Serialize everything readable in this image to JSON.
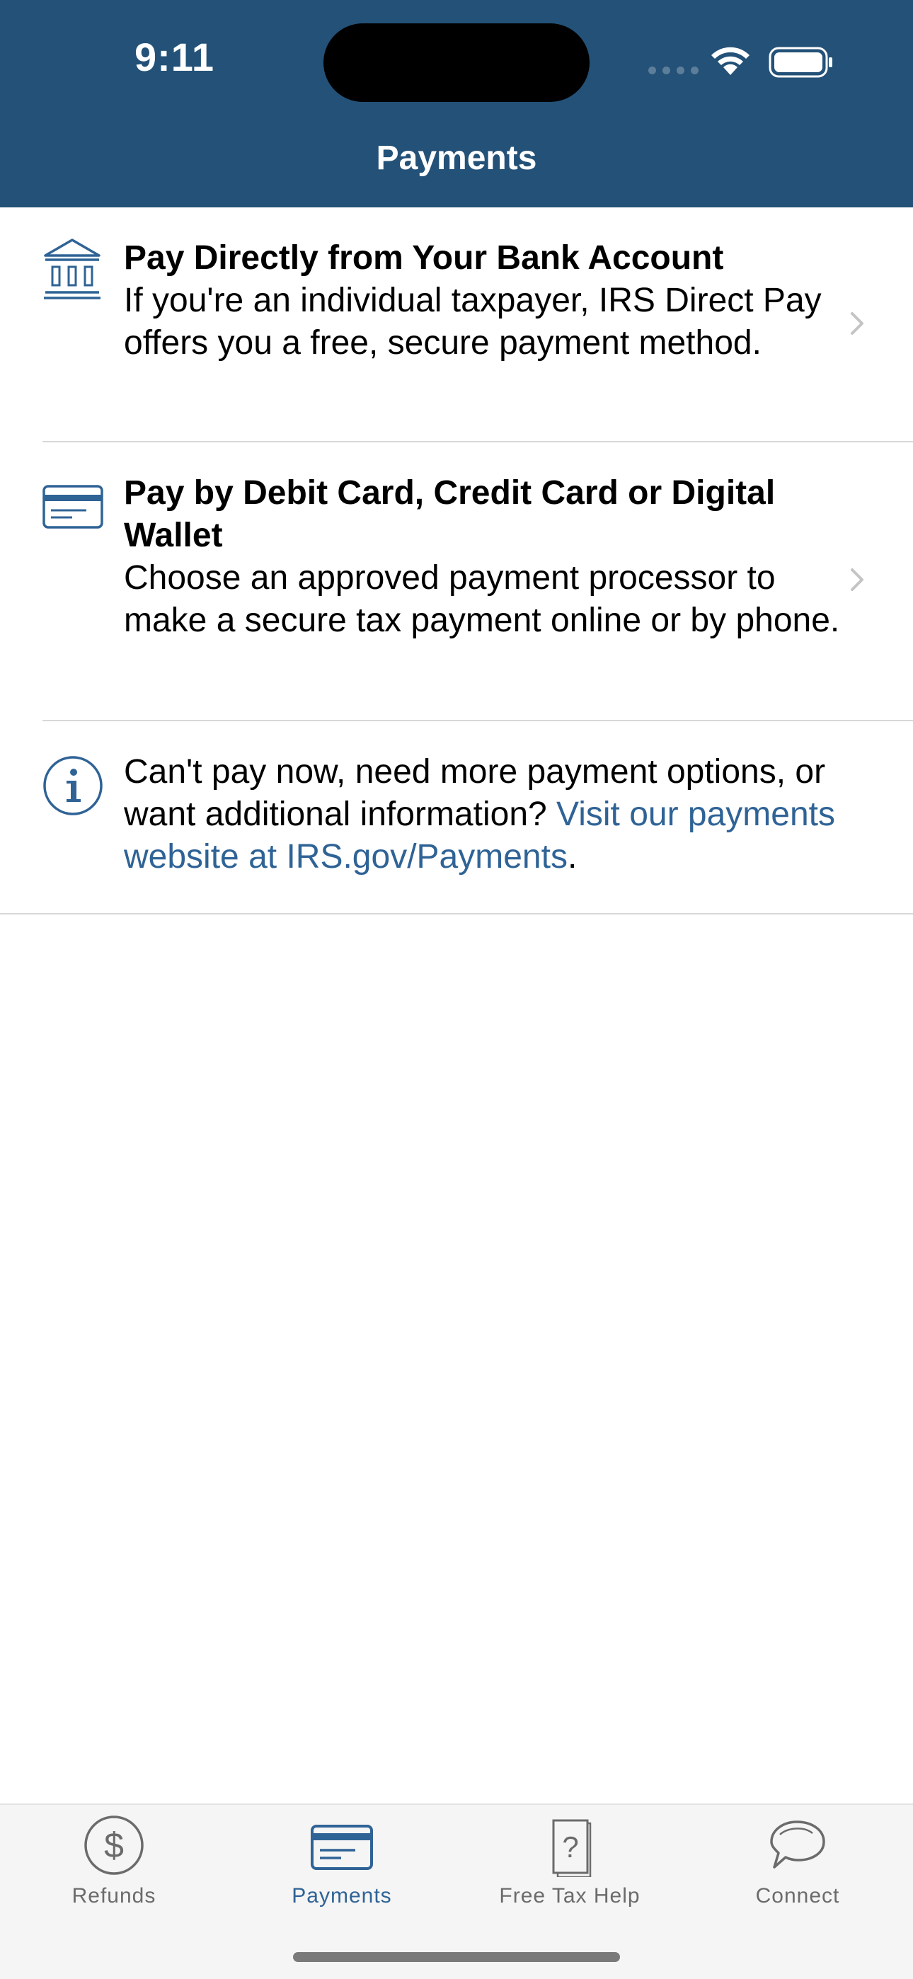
{
  "status_bar": {
    "time": "9:11"
  },
  "header": {
    "title": "Payments"
  },
  "items": [
    {
      "icon": "bank-icon",
      "title": "Pay Directly from Your Bank Account",
      "description": "If you're an individual taxpayer, IRS Direct Pay offers you a free, secure payment method."
    },
    {
      "icon": "credit-card-icon",
      "title": "Pay by Debit Card, Credit Card or Digital Wallet",
      "description": "Choose an approved payment processor to make a secure tax payment online or by phone."
    }
  ],
  "info": {
    "icon": "info-icon",
    "text": "Can't pay now, need more payment options, or want additional information? ",
    "link_text": "Visit our payments website at IRS.gov/Payments",
    "suffix": "."
  },
  "tabs": [
    {
      "label": "Refunds",
      "icon": "dollar-icon",
      "active": false
    },
    {
      "label": "Payments",
      "icon": "credit-card-icon",
      "active": true
    },
    {
      "label": "Free Tax Help",
      "icon": "question-document-icon",
      "active": false
    },
    {
      "label": "Connect",
      "icon": "speech-bubbles-icon",
      "active": false
    }
  ],
  "colors": {
    "header": "#235177",
    "accent": "#2f6396",
    "tabbar": "#f5f5f5"
  }
}
